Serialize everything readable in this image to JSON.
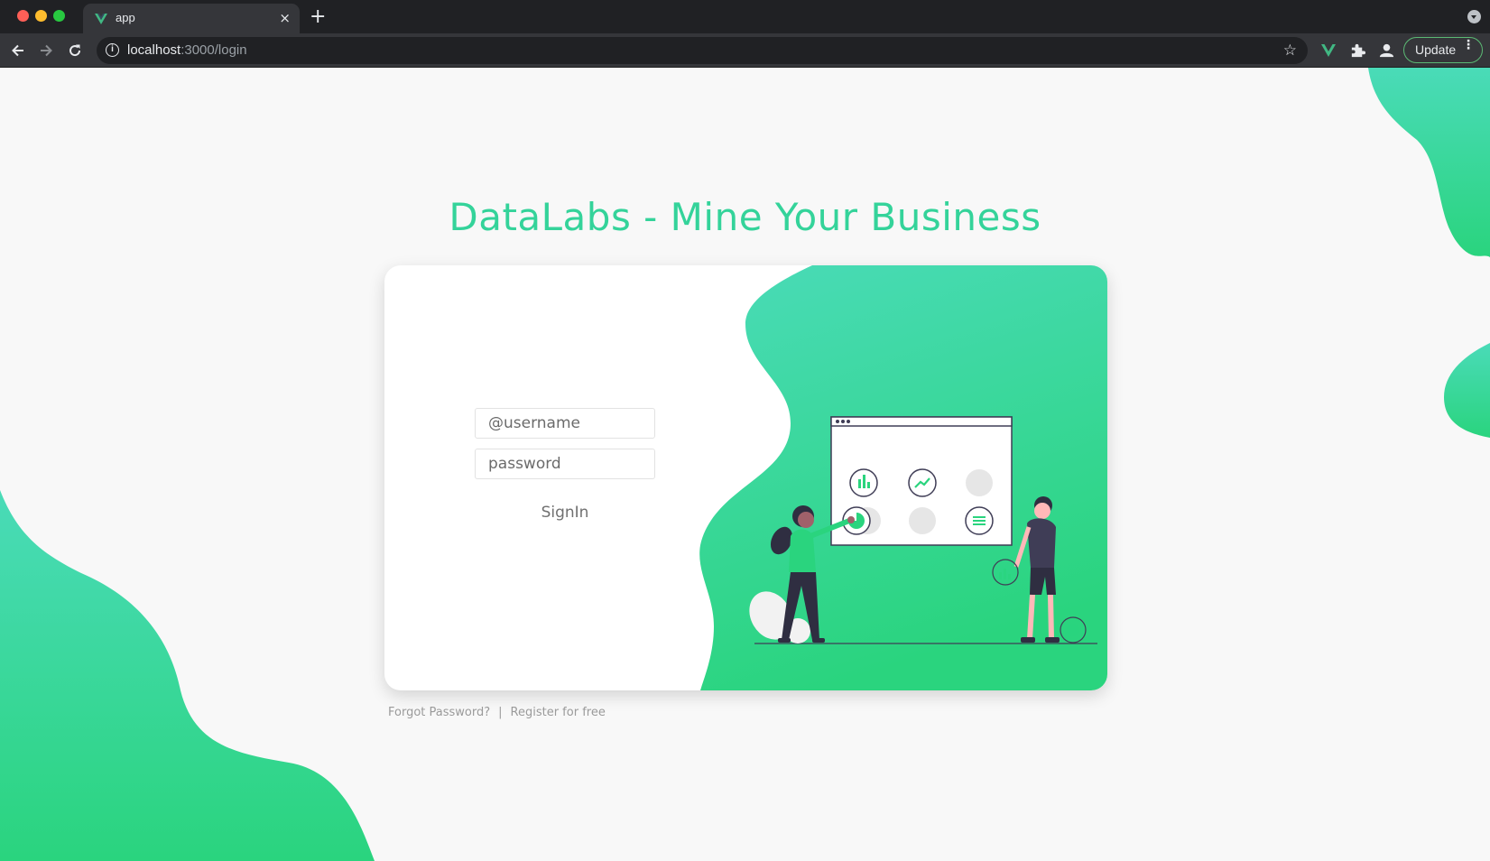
{
  "browser": {
    "tab_title": "app",
    "tab_close_glyph": "×",
    "new_tab_glyph": "+",
    "url_host": "localhost",
    "url_path": ":3000/login",
    "update_label": "Update",
    "menu_glyph": "⋮",
    "star_glyph": "☆",
    "icons": [
      "back-icon",
      "forward-icon",
      "reload-icon",
      "info-icon",
      "star-icon",
      "vue-devtools-icon",
      "extensions-icon",
      "profile-icon",
      "menu-icon"
    ]
  },
  "login": {
    "heading": "DataLabs - Mine Your Business",
    "username_placeholder": "@username",
    "password_placeholder": "password",
    "signin_label": "SignIn",
    "forgot_label": "Forgot Password?",
    "separator": "|",
    "register_label": "Register for free"
  },
  "colors": {
    "accent": "#34d39a",
    "gradient_top": "#4adbb8",
    "gradient_bottom": "#2ad47e",
    "page_bg": "#f8f8f8"
  }
}
